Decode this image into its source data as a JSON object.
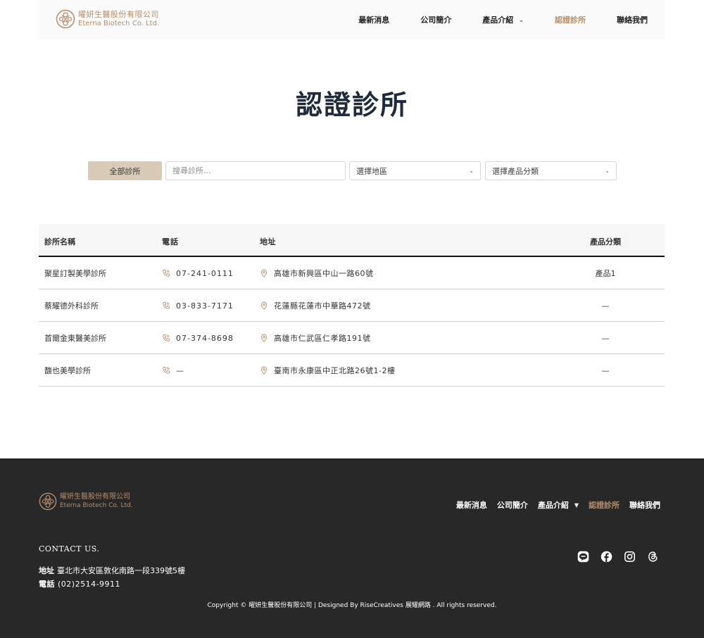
{
  "brand": {
    "name_cn": "曜妍生醫股份有限公司",
    "name_en": "Eterna Biotech Co. Ltd."
  },
  "nav": [
    {
      "label": "最新消息",
      "active": false,
      "dropdown": false
    },
    {
      "label": "公司簡介",
      "active": false,
      "dropdown": false
    },
    {
      "label": "產品介紹",
      "active": false,
      "dropdown": true
    },
    {
      "label": "認證診所",
      "active": true,
      "dropdown": false
    },
    {
      "label": "聯絡我們",
      "active": false,
      "dropdown": false
    }
  ],
  "page_title": "認證診所",
  "filters": {
    "all_label": "全部診所",
    "search_placeholder": "搜尋診所...",
    "region_label": "選擇地區",
    "product_label": "選擇產品分類"
  },
  "table": {
    "headers": {
      "name": "診所名稱",
      "phone": "電話",
      "address": "地址",
      "category": "產品分類"
    },
    "rows": [
      {
        "name": "聚星訂製美學診所",
        "phone": "07-241-0111",
        "address": "高雄市新興區中山一路60號",
        "category": "產品1"
      },
      {
        "name": "蔡耀德外科診所",
        "phone": "03-833-7171",
        "address": "花蓮縣花蓮市中華路472號",
        "category": "—"
      },
      {
        "name": "首爾金東醫美診所",
        "phone": "07-374-8698",
        "address": "高雄市仁武區仁孝路191號",
        "category": "—"
      },
      {
        "name": "馥也美學診所",
        "phone": "—",
        "address": "臺南市永康區中正北路26號1-2樓",
        "category": "—"
      }
    ]
  },
  "footer": {
    "nav": [
      {
        "label": "最新消息",
        "active": false,
        "dropdown": false
      },
      {
        "label": "公司簡介",
        "active": false,
        "dropdown": false
      },
      {
        "label": "產品介紹",
        "active": false,
        "dropdown": true
      },
      {
        "label": "認證診所",
        "active": true,
        "dropdown": false
      },
      {
        "label": "聯絡我們",
        "active": false,
        "dropdown": false
      }
    ],
    "contact_title": "CONTACT US.",
    "address_label": "地址",
    "address": "臺北市大安區敦化南路一段339號5樓",
    "tel_label": "電話",
    "tel": "(02)2514-9911",
    "socials": [
      "line-icon",
      "facebook-icon",
      "instagram-icon",
      "threads-icon"
    ],
    "copyright": "Copyright © 曜妍生醫股份有限公司 | Designed By RiseCreatives 展耀網路 . All rights reserved."
  },
  "colors": {
    "accent": "#b68e6b",
    "button_bg": "#d8cbb8",
    "footer_bg": "#282828",
    "title": "#1f2a3a"
  }
}
